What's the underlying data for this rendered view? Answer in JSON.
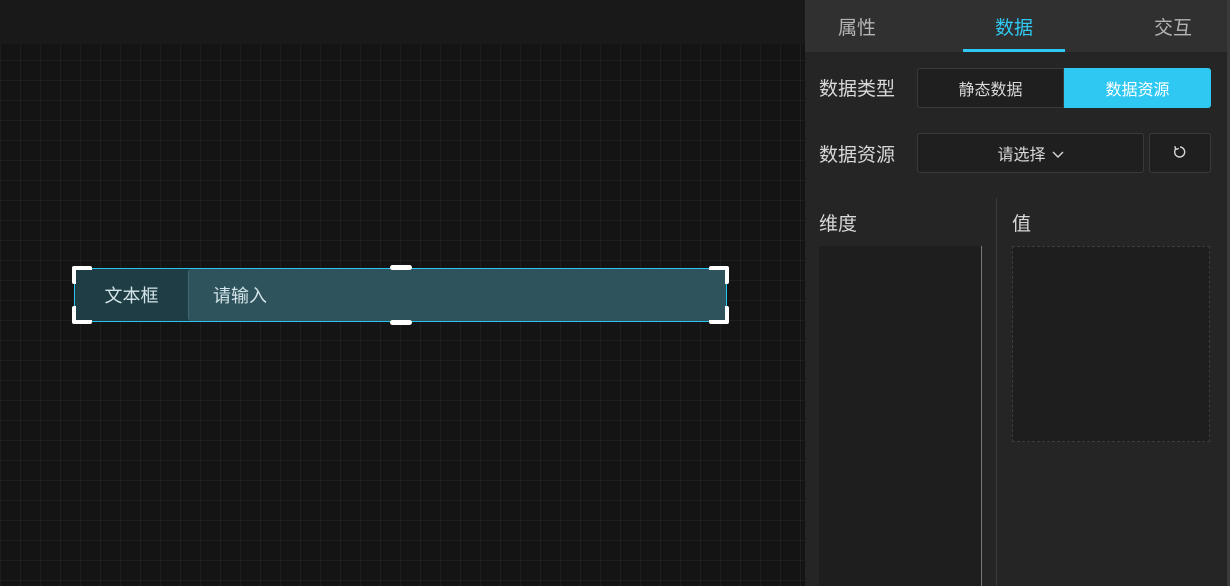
{
  "canvas": {
    "widget": {
      "label": "文本框",
      "input_placeholder": "请输入"
    }
  },
  "panel": {
    "tabs": [
      {
        "label": "属性",
        "active": false
      },
      {
        "label": "数据",
        "active": true
      },
      {
        "label": "交互",
        "active": false
      }
    ],
    "data_type": {
      "label": "数据类型",
      "options": [
        "静态数据",
        "数据资源"
      ],
      "selected": "数据资源"
    },
    "data_source": {
      "label": "数据资源",
      "select_placeholder": "请选择",
      "select_icon": "chevron-down-icon",
      "refresh_icon": "refresh-icon"
    },
    "dimension": {
      "label": "维度"
    },
    "value": {
      "label": "值"
    }
  },
  "colors": {
    "accent": "#2fc8f2",
    "panel_bg": "#252525",
    "canvas_bg": "#141414"
  }
}
